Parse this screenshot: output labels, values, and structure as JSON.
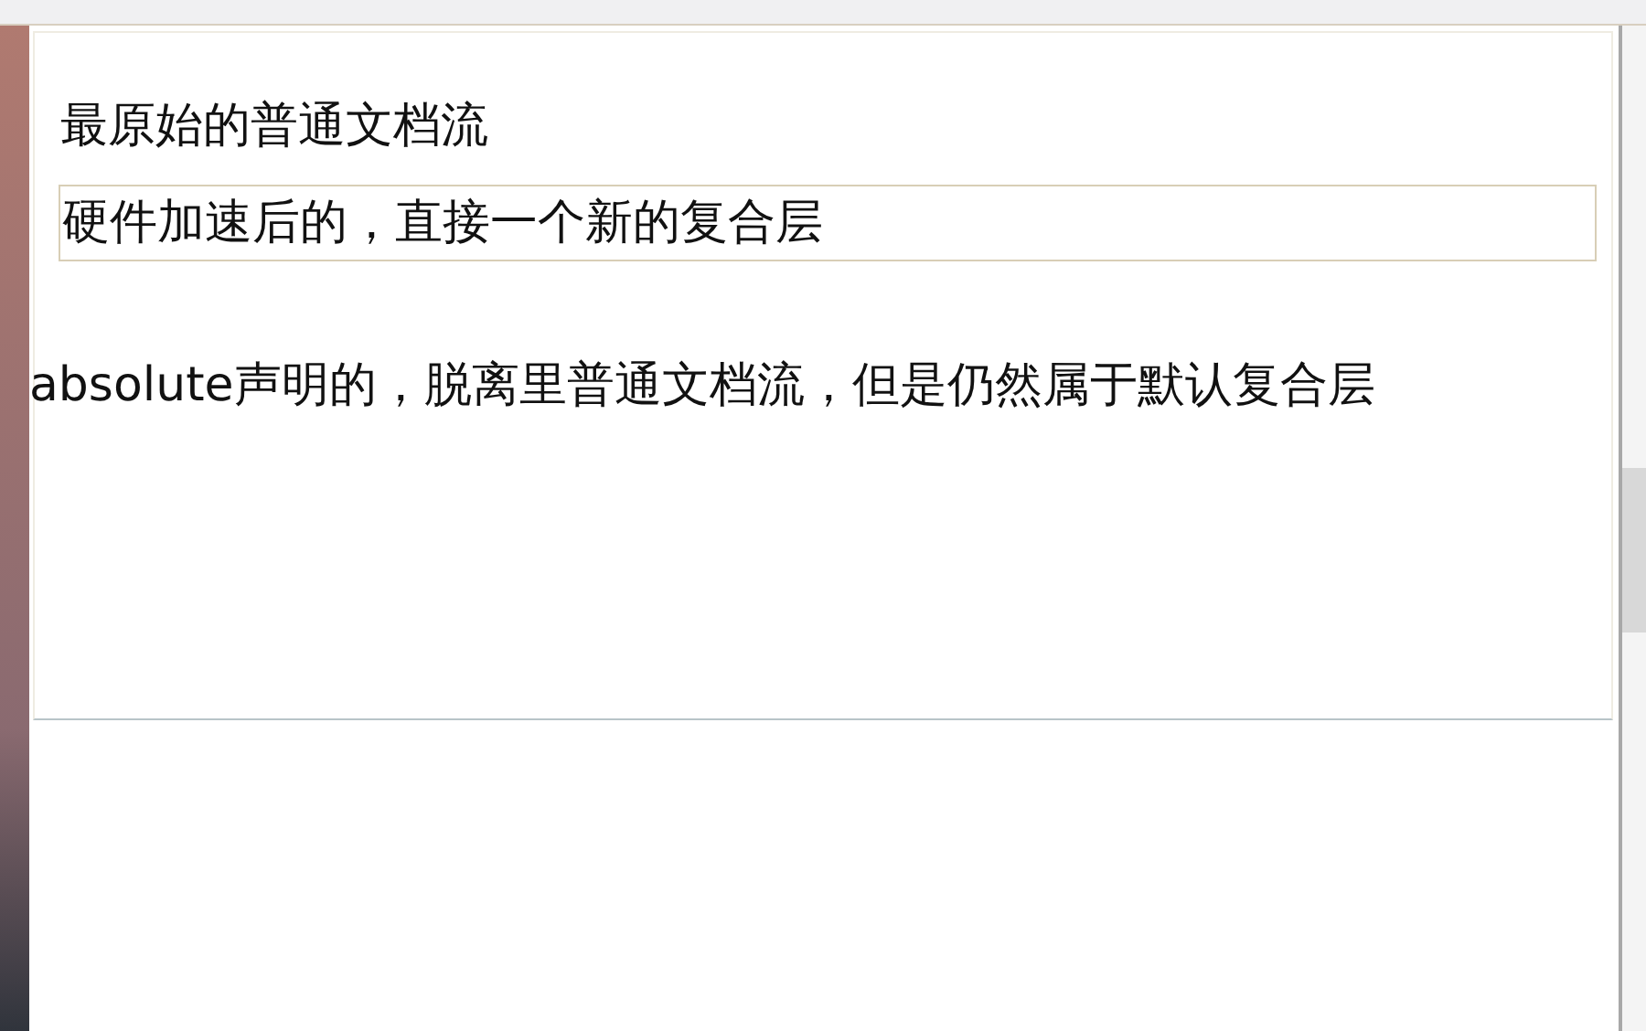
{
  "blocks": [
    {
      "kind": "normal",
      "text": "最原始的普通文档流"
    },
    {
      "kind": "composited",
      "text": "硬件加速后的，直接一个新的复合层"
    },
    {
      "kind": "absolute",
      "text": "absolute声明的，脱离里普通文档流，但是仍然属于默认复合层"
    }
  ]
}
